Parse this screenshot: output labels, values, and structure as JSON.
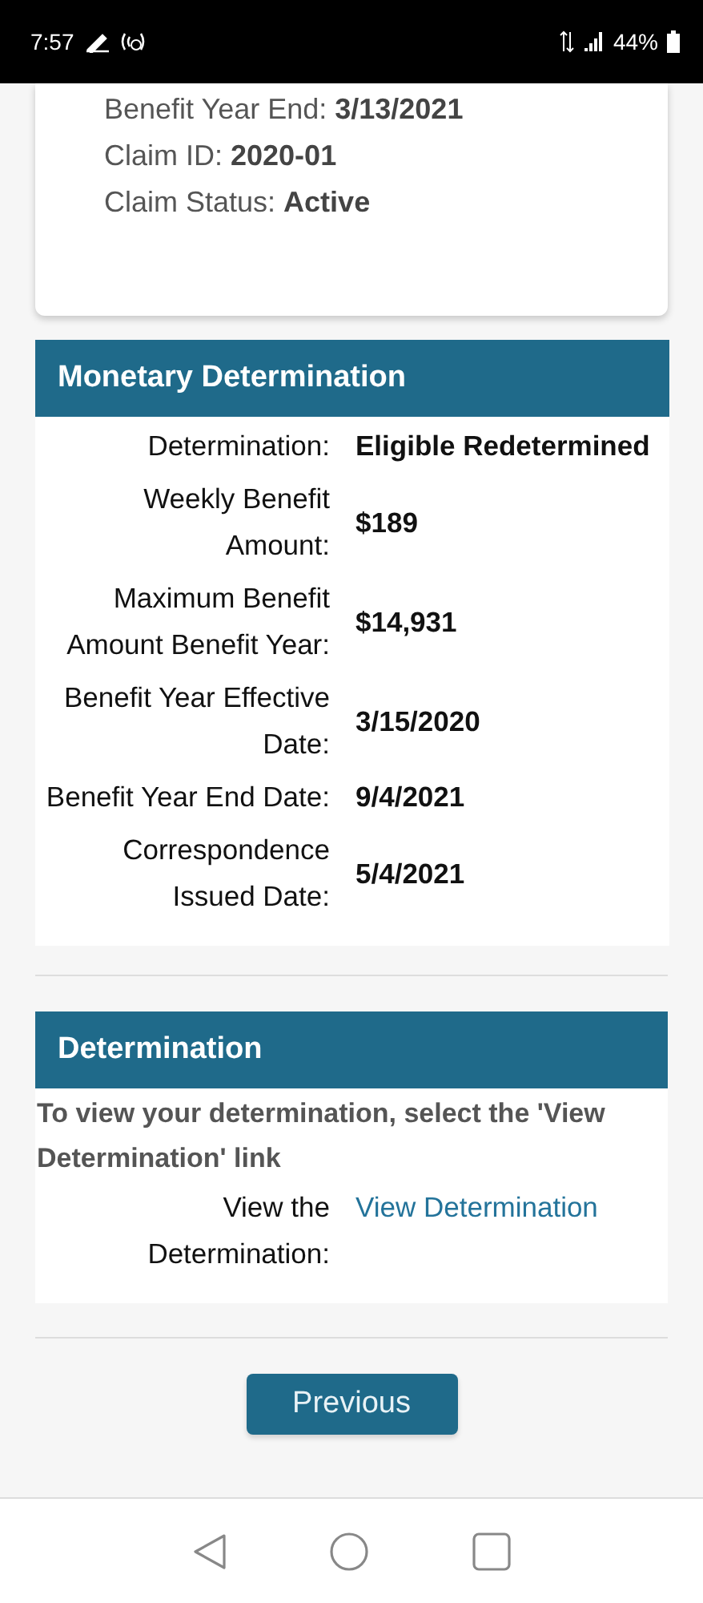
{
  "status_bar": {
    "time": "7:57",
    "battery": "44%"
  },
  "claim_card": {
    "lines": [
      {
        "label": "Benefit Year End: ",
        "value": "3/13/2021"
      },
      {
        "label": "Claim ID: ",
        "value": "2020-01"
      },
      {
        "label": "Claim Status: ",
        "value": "Active"
      }
    ]
  },
  "monetary_determination": {
    "title": "Monetary Determination",
    "rows": [
      {
        "label": "Determination:",
        "value": "Eligible Redetermined"
      },
      {
        "label": "Weekly Benefit Amount:",
        "value": "$189"
      },
      {
        "label": "Maximum Benefit Amount Benefit Year:",
        "value": "$14,931"
      },
      {
        "label": "Benefit Year Effective Date:",
        "value": "3/15/2020"
      },
      {
        "label": "Benefit Year End Date:",
        "value": "9/4/2021"
      },
      {
        "label": "Correspondence Issued Date:",
        "value": "5/4/2021"
      }
    ]
  },
  "determination": {
    "title": "Determination",
    "instruction": "To view your determination, select the 'View Determination' link",
    "row": {
      "label": "View the Determination:",
      "link": "View Determination"
    }
  },
  "buttons": [
    "Previous"
  ]
}
